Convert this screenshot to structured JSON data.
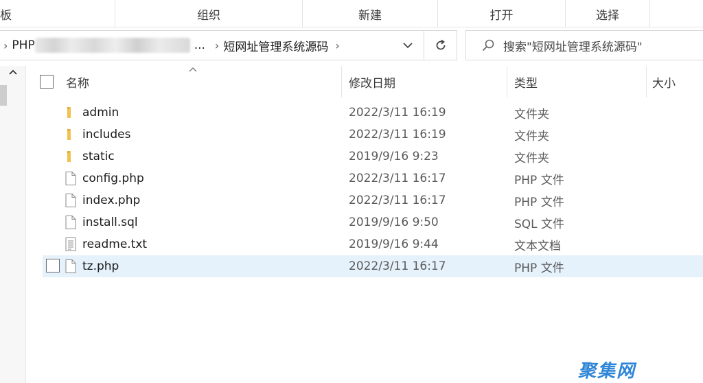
{
  "ribbon": {
    "cut_label": "板",
    "groups": [
      "组织",
      "新建",
      "打开",
      "选择"
    ]
  },
  "address": {
    "root": "PHP",
    "ellipsis": "...",
    "current": "短网址管理系统源码"
  },
  "search": {
    "placeholder": "搜索\"短网址管理系统源码\""
  },
  "columns": {
    "name": "名称",
    "modified": "修改日期",
    "type": "类型",
    "size": "大小"
  },
  "files": [
    {
      "name": "admin",
      "date": "2022/3/11 16:19",
      "type": "文件夹",
      "icon": "folder-icon"
    },
    {
      "name": "includes",
      "date": "2022/3/11 16:19",
      "type": "文件夹",
      "icon": "folder-icon"
    },
    {
      "name": "static",
      "date": "2019/9/16 9:23",
      "type": "文件夹",
      "icon": "folder-icon"
    },
    {
      "name": "config.php",
      "date": "2022/3/11 16:17",
      "type": "PHP 文件",
      "icon": "file-icon"
    },
    {
      "name": "index.php",
      "date": "2022/3/11 16:17",
      "type": "PHP 文件",
      "icon": "file-icon"
    },
    {
      "name": "install.sql",
      "date": "2019/9/16 9:50",
      "type": "SQL 文件",
      "icon": "file-icon"
    },
    {
      "name": "readme.txt",
      "date": "2019/9/16 9:44",
      "type": "文本文档",
      "icon": "text-file-icon"
    },
    {
      "name": "tz.php",
      "date": "2022/3/11 16:17",
      "type": "PHP 文件",
      "icon": "file-icon"
    }
  ],
  "watermark": "聚集网",
  "colors": {
    "selection": "#e5f1fb",
    "folder": "#f2c14e",
    "watermark": "#2f86d6"
  }
}
